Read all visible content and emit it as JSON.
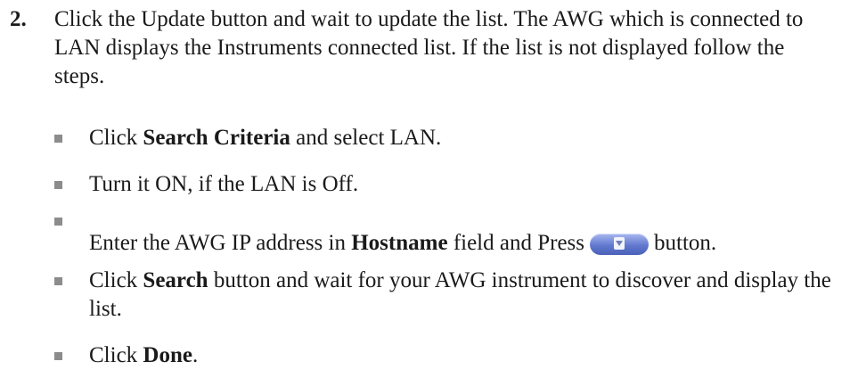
{
  "step": {
    "number": "2.",
    "text": "Click the Update button and wait to update the list. The AWG which is connected to LAN displays the Instruments connected list. If the list is not displayed follow the steps."
  },
  "bullets": [
    {
      "pre": "Click ",
      "bold": "Search Criteria",
      "post": " and select LAN."
    },
    {
      "text": "Turn it ON, if the LAN is Off."
    },
    {
      "pre": "Enter the AWG IP address in ",
      "bold": "Hostname",
      "mid": " field and Press",
      "post": "button.",
      "icon": "blue-pill-arrow-button-icon"
    },
    {
      "pre": "Click ",
      "bold": "Search",
      "post": " button and wait for your AWG instrument to discover and display the list."
    },
    {
      "pre": "Click ",
      "bold": "Done",
      "post": "."
    }
  ],
  "colors": {
    "bullet": "#8c8c8c",
    "text": "#1a1a1a",
    "button_blue": "#6279cf"
  }
}
